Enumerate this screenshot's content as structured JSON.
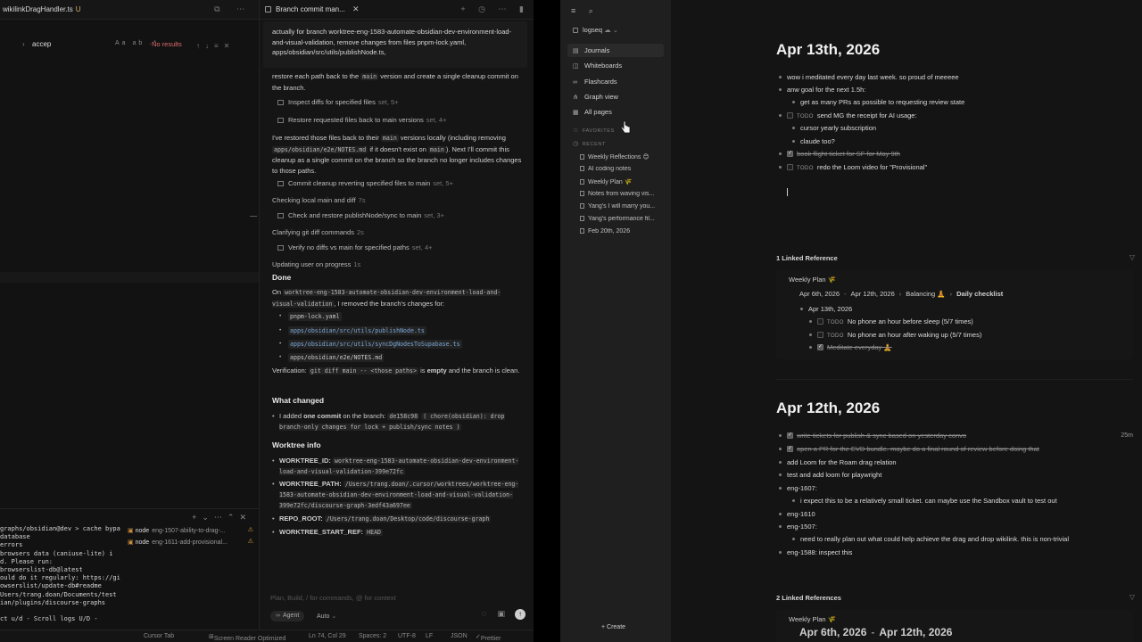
{
  "editor": {
    "tab_title": "wikilinkDragHandler.ts",
    "tab_modified": "U",
    "find": {
      "query": "accep",
      "options": "Aa ab .*",
      "no_results": "No results"
    }
  },
  "terminal": {
    "lines": [
      "graphs/obsidian@dev > cache bypa",
      " database",
      " errors",
      " browsers data (caniuse-lite) i",
      "d. Please run:",
      "browserslist-db@latest",
      "ould do it regularly: https://gi",
      "owserslist/update-db#readme",
      "Users/trang.doan/Documents/test",
      "ian/plugins/discourse-graphs",
      "",
      "ct   u/d - Scroll logs   U/D -"
    ],
    "processes": [
      {
        "name": "node",
        "branch": "eng-1507-ability-to-drag-..."
      },
      {
        "name": "node",
        "branch": "eng-1611-add-provisional..."
      }
    ]
  },
  "statusbar": {
    "items": [
      "Cursor Tab",
      "Screen Reader Optimized",
      "Ln 74, Col 29",
      "Spaces: 2",
      "UTF-8",
      "LF",
      "JSON",
      "Prettier"
    ]
  },
  "chat": {
    "tab_title": "Branch commit man...",
    "top_text": "actually for branch worktree-eng-1583-automate-obsidian-dev-environment-load-and-visual-validation, remove changes from files pnpm-lock.yaml, apps/obsidian/src/utils/publishNode.ts,",
    "p1_a": "restore each path back to the",
    "p1_code": "main",
    "p1_b": "version and create a single cleanup commit on the branch.",
    "steps1": [
      {
        "label": "Inspect diffs for specified files",
        "meta": "set, 5+"
      },
      {
        "label": "Restore requested files back to main versions",
        "meta": "set, 4+"
      }
    ],
    "p2_a": "I've restored those files back to their",
    "p2_code1": "main",
    "p2_b": "versions locally (including removing",
    "p2_code2": "apps/obsidian/e2e/NOTES.md",
    "p2_c": "if it doesn't exist on",
    "p2_code3": "main",
    "p2_d": "). Next I'll commit this cleanup as a single commit on the branch so the branch no longer includes changes to those paths.",
    "step_commit": {
      "label": "Commit cleanup reverting specified files to main",
      "meta": "set, 5+"
    },
    "status_checking": {
      "label": "Checking local main and diff",
      "meta": "7s"
    },
    "step_check": {
      "label": "Check and restore publishNode/sync to main",
      "meta": "set, 3+"
    },
    "status_clarifying": {
      "label": "Clarifying git diff commands",
      "meta": "2s"
    },
    "step_verify": {
      "label": "Verify no diffs vs main for specified paths",
      "meta": "set, 4+"
    },
    "status_updating": {
      "label": "Updating user on progress",
      "meta": "1s"
    },
    "done_heading": "Done",
    "done_a": "On",
    "done_code": "worktree-eng-1583-automate-obsidian-dev-environment-load-and-visual-validation",
    "done_b": ", I removed the branch's changes for:",
    "files": [
      {
        "path": "pnpm-lock.yaml",
        "link": false
      },
      {
        "path": "apps/obsidian/src/utils/publishNode.ts",
        "link": true
      },
      {
        "path": "apps/obsidian/src/utils/syncDgNodesToSupabase.ts",
        "link": true
      },
      {
        "path": "apps/obsidian/e2e/NOTES.md",
        "link": false
      }
    ],
    "verif_a": "Verification:",
    "verif_code": "git diff main -- <those paths>",
    "verif_b": "is",
    "verif_bold": "empty",
    "verif_c": "and the branch is clean.",
    "changed_heading": "What changed",
    "changed_a": "I added",
    "changed_bold": "one commit",
    "changed_b": "on the branch:",
    "changed_hash": "de158c98",
    "changed_msg": "( chore(obsidian): drop branch-only changes for lock + publish/sync notes )",
    "worktree_heading": "Worktree info",
    "worktree": [
      {
        "key": "WORKTREE_ID:",
        "val": "worktree-eng-1583-automate-obsidian-dev-environment-load-and-visual-validation-399e72fc"
      },
      {
        "key": "WORKTREE_PATH:",
        "val": "/Users/trang.doan/.cursor/worktrees/worktree-eng-1583-automate-obsidian-dev-environment-load-and-visual-validation-399e72fc/discourse-graph-3edf43a697ee"
      },
      {
        "key": "REPO_ROOT:",
        "val": "/Users/trang.doan/Desktop/code/discourse-graph"
      },
      {
        "key": "WORKTREE_START_REF:",
        "val": "HEAD"
      }
    ],
    "input": {
      "placeholder": "Plan, Build, / for commands, @ for context",
      "mode_icon": "∞",
      "mode": "Agent",
      "model": "Auto"
    }
  },
  "logseq": {
    "graph_name": "logseq",
    "nav": [
      {
        "icon": "▤",
        "label": "Journals"
      },
      {
        "icon": "◫",
        "label": "Whiteboards"
      },
      {
        "icon": "∞",
        "label": "Flashcards"
      },
      {
        "icon": "⋔",
        "label": "Graph view"
      },
      {
        "icon": "▦",
        "label": "All pages"
      }
    ],
    "favorites_label": "FAVORITES",
    "recent_label": "RECENT",
    "recent": [
      "Weekly Reflections 😊",
      "AI coding notes",
      "Weekly Plan 🌾",
      "Notes from waving vis...",
      "Yang's I will marry you...",
      "Yang's performance fil...",
      "Feb 20th, 2026"
    ],
    "create_label": "+ Create"
  },
  "journal1": {
    "title": "Apr 13th, 2026",
    "blocks": {
      "b1": "wow i meditated every day last week. so proud of meeeee",
      "b2": "anw goal for the next 1.5h:",
      "b3": "get as many PRs as possible to requesting review state",
      "b4_todo": "TODO",
      "b4": "send MG the receipt for AI usage:",
      "b5": "cursor yearly subscription",
      "b6": "claude too?",
      "b7": "book flight ticket for SF for May 9th",
      "b8_todo": "TODO",
      "b8": "redo the Loom video for \"Provisional\""
    },
    "linked_heading": "1 Linked Reference",
    "ref": {
      "page": "Weekly Plan 🌾",
      "from": "Apr 6th, 2026",
      "dash": "-",
      "to": "Apr 12th, 2026",
      "mid": "Balancing 🧘",
      "last": "Daily checklist",
      "child_date": "Apr 13th, 2026",
      "todo1_tag": "TODO",
      "todo1": "No phone an hour before sleep (5/7 times)",
      "todo2_tag": "TODO",
      "todo2": "No phone an hour after waking up (5/7 times)",
      "done1": "Meditate everyday 🧘"
    }
  },
  "journal2": {
    "title": "Apr 12th, 2026",
    "blocks": {
      "b1": "write tickets for publish & sync based on yesterday convo",
      "b1_time": "25m",
      "b2": "open a PR for the EVD bundle. maybe do a final round of review before doing that",
      "b3": "add Loom for the Roam drag relation",
      "b4": "test and add loom for playwright",
      "b5": "eng-1607:",
      "b6": "i expect this to be a relatively small ticket. can maybe use the Sandbox vault to test out",
      "b7": "eng-1610",
      "b8": "eng-1507:",
      "b9": "need to really plan out what could help achieve the drag and drop wikilink. this is non-trivial",
      "b10": "eng-1588: inspect this"
    },
    "linked_heading": "2 Linked References",
    "ref": {
      "page": "Weekly Plan 🌾",
      "from": "Apr 6th, 2026",
      "dash": "-",
      "to": "Apr 12th, 2026"
    }
  }
}
